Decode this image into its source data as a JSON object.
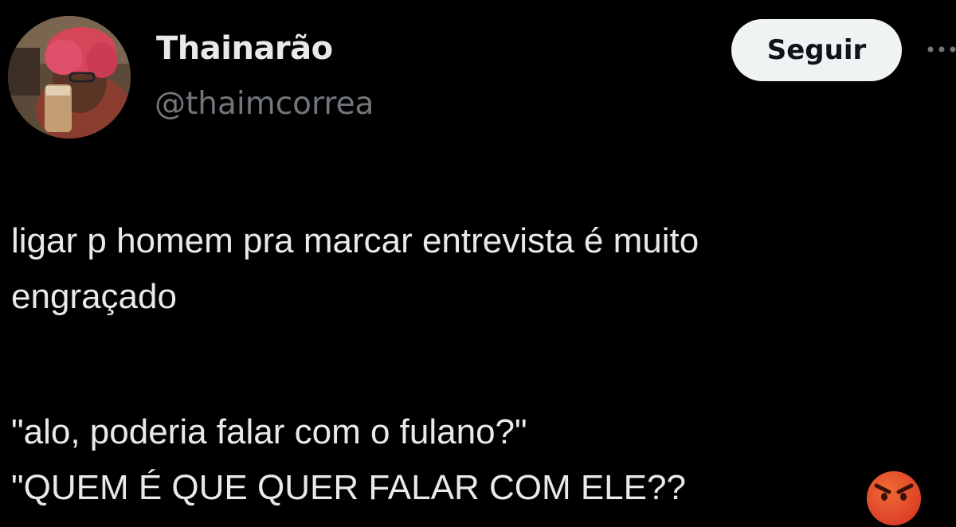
{
  "author": {
    "display_name": "Thainarão",
    "handle": "@thaimcorrea",
    "avatar_icon": "profile-photo"
  },
  "follow_button": {
    "label": "Seguir"
  },
  "more_icon": "more-options-icon",
  "tweet": {
    "lines": [
      "ligar p homem pra marcar entrevista é muito",
      "engraçado",
      "\"alo, poderia falar com o fulano?\"",
      "\"QUEM É QUE QUER FALAR COM ELE??"
    ],
    "emoji": "angry-face-icon"
  },
  "colors": {
    "background": "#000000",
    "text": "#e7e9ea",
    "secondary_text": "#71767b",
    "button_bg": "#eff3f4",
    "button_text": "#0f1419"
  }
}
